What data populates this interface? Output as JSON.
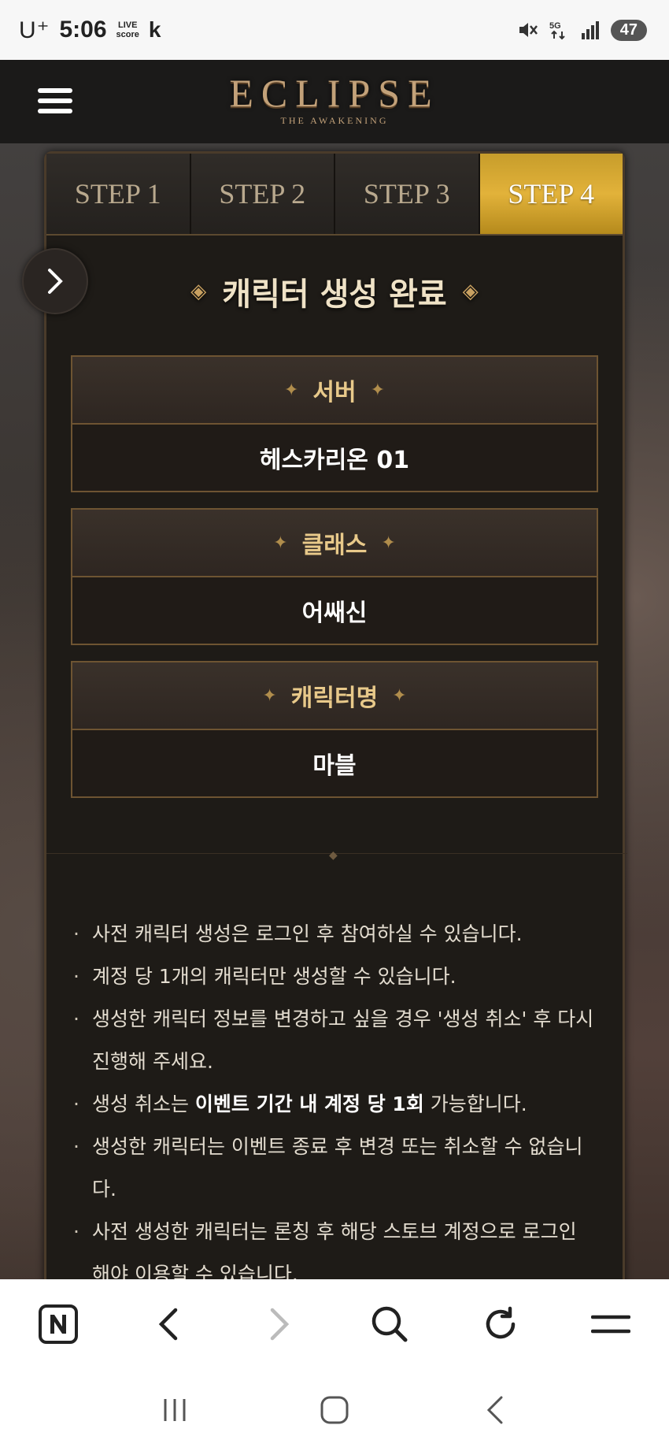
{
  "status_bar": {
    "carrier": "U⁺",
    "time": "5:06",
    "livescore": [
      "LIVE",
      "score"
    ],
    "k_label": "k",
    "battery": "47"
  },
  "header": {
    "logo_main": "ECLIPSE",
    "logo_sub": "THE AWAKENING"
  },
  "tabs": [
    {
      "label": "STEP 1",
      "active": false
    },
    {
      "label": "STEP 2",
      "active": false
    },
    {
      "label": "STEP 3",
      "active": false
    },
    {
      "label": "STEP 4",
      "active": true
    }
  ],
  "section": {
    "title": "캐릭터 생성 완료"
  },
  "info": {
    "server": {
      "label": "서버",
      "value": "헤스카리온 01"
    },
    "class": {
      "label": "클래스",
      "value": "어쌔신"
    },
    "name": {
      "label": "캐릭터명",
      "value": "마블"
    }
  },
  "notes": [
    "사전 캐릭터 생성은 로그인 후 참여하실 수 있습니다.",
    "계정 당 1개의 캐릭터만 생성할 수 있습니다.",
    "생성한 캐릭터 정보를 변경하고 싶을 경우 '생성 취소' 후 다시 진행해 주세요.",
    {
      "prefix": "생성 취소는 ",
      "bold": "이벤트 기간 내 계정 당 1회",
      "suffix": " 가능합니다."
    },
    "생성한 캐릭터는 이벤트 종료 후 변경 또는 취소할 수 없습니다.",
    "사전 생성한 캐릭터는 론칭 후 해당 스토브 계정으로 로그인해야 이용할 수 있습니다."
  ],
  "colors": {
    "accent_gold": "#e2b23a",
    "header_bg": "#1b1a19",
    "panel_bg": "#1e1b17"
  },
  "icons": {
    "browser_toolbar": [
      "naver-home-icon",
      "back-icon",
      "forward-icon",
      "search-icon",
      "refresh-icon",
      "menu-icon"
    ],
    "nav_bar": [
      "recents-icon",
      "home-icon",
      "back-icon"
    ]
  }
}
